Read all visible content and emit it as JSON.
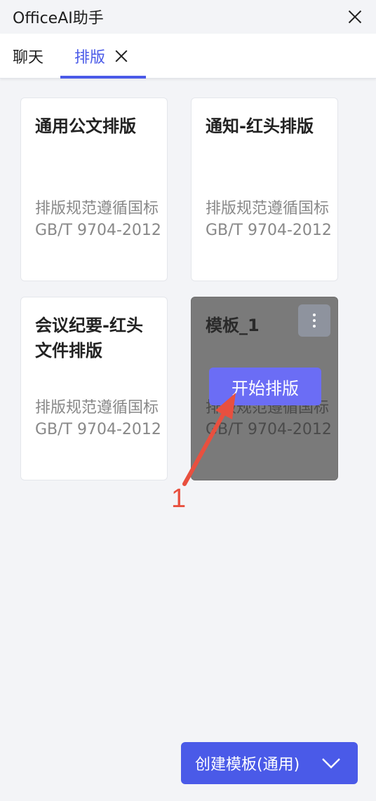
{
  "window": {
    "title": "OfficeAI助手"
  },
  "tabs": [
    {
      "label": "聊天"
    },
    {
      "label": "排版"
    }
  ],
  "cards": [
    {
      "title": "通用公文排版",
      "description": "排版规范遵循国标GB/T 9704-2012"
    },
    {
      "title": "通知-红头排版",
      "description": "排版规范遵循国标GB/T 9704-2012"
    },
    {
      "title": "会议纪要-红头文件排版",
      "description": "排版规范遵循国标GB/T 9704-2012"
    },
    {
      "title": "模板_1",
      "description": "排版规范遵循国标GB/T 9704-2012",
      "hover_button": "开始排版"
    }
  ],
  "annotation": {
    "label": "1",
    "color": "#e8503f"
  },
  "create_button": {
    "label": "创建模板(通用)"
  },
  "colors": {
    "accent": "#4a5ae8",
    "start_button": "#6b6df5"
  }
}
